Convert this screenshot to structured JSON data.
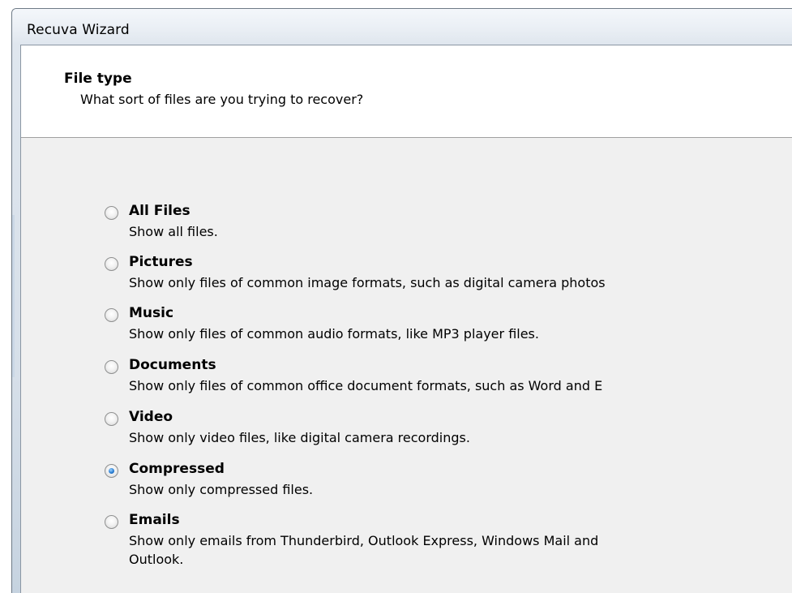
{
  "window": {
    "title": "Recuva Wizard"
  },
  "header": {
    "title": "File type",
    "subtitle": "What sort of files are you trying to recover?"
  },
  "options": [
    {
      "label": "All Files",
      "description": "Show all files.",
      "selected": false
    },
    {
      "label": "Pictures",
      "description": "Show only files of common image formats, such as digital camera photos",
      "selected": false
    },
    {
      "label": "Music",
      "description": "Show only files of common audio formats, like MP3 player files.",
      "selected": false
    },
    {
      "label": "Documents",
      "description": "Show only files of common office document formats, such as Word and E",
      "selected": false
    },
    {
      "label": "Video",
      "description": "Show only video files, like digital camera recordings.",
      "selected": false
    },
    {
      "label": "Compressed",
      "description": "Show only compressed files.",
      "selected": true
    },
    {
      "label": "Emails",
      "description": "Show only emails from Thunderbird, Outlook Express, Windows Mail and",
      "description_line2": "Outlook.",
      "selected": false
    }
  ],
  "colors": {
    "header_background": "#ffffff",
    "body_background": "#f0f0f0",
    "radio_selected_dot": "#2a7ed3"
  }
}
